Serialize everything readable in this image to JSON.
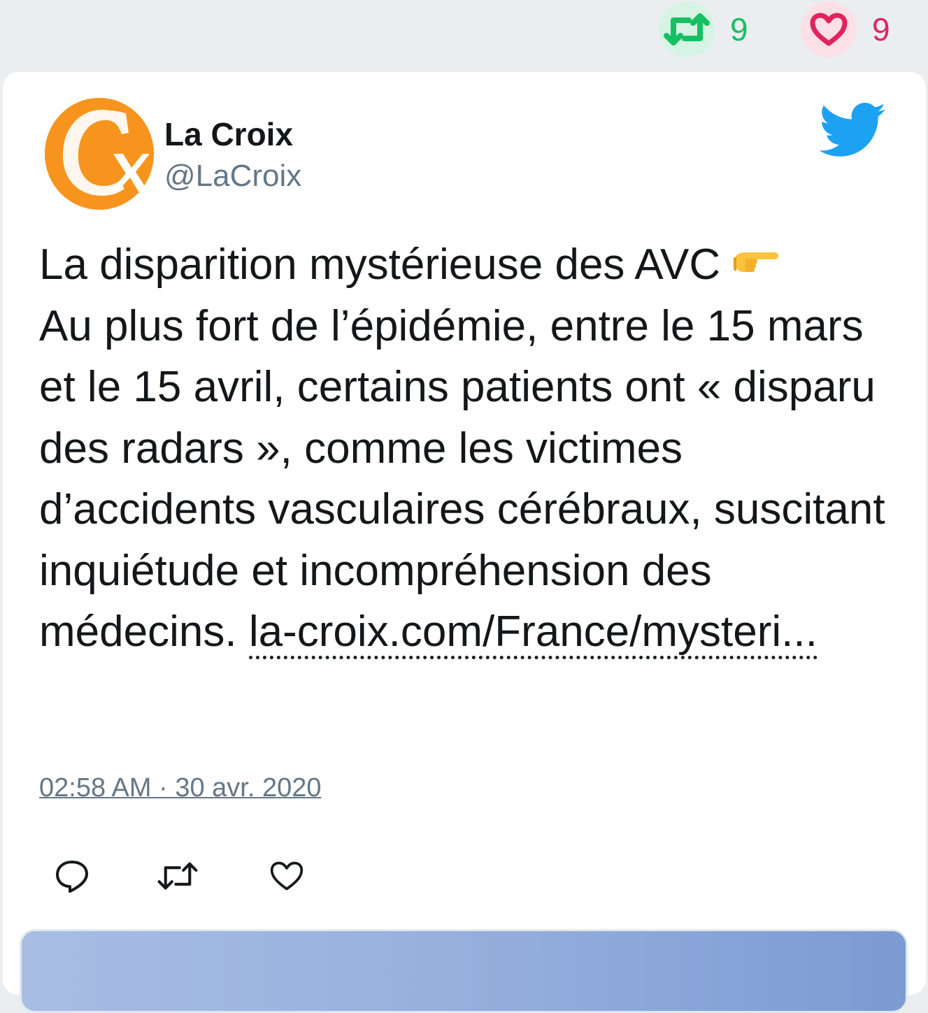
{
  "top_stats": {
    "retweet_count": "9",
    "like_count": "9",
    "retweet_icon": "retweet-icon",
    "like_icon": "heart-icon"
  },
  "tweet": {
    "author_name": "La Croix",
    "author_handle": "@LaCroix",
    "text_line1": "La disparition mystérieuse des AVC ",
    "emoji": "backhand-index-pointing-right",
    "text_body": "\nAu plus fort de l’épidémie, entre le 15 mars et le 15 avril, certains patients ont « disparu des radars », comme les victimes d’accidents vasculaires cérébraux, suscitant inquiétude et incompréhension des médecins. ",
    "link_text": "la-croix.com/France/mysteri...",
    "timestamp": "02:58 AM · 30 avr. 2020"
  },
  "actions": {
    "reply_icon": "reply-icon",
    "retweet_icon": "retweet-icon",
    "like_icon": "heart-icon"
  },
  "colors": {
    "retweet_green": "#17bf63",
    "like_red": "#e0245e",
    "twitter_blue": "#1da1f2",
    "avatar_orange": "#f7941d",
    "muted_text": "#657786",
    "text": "#14171a",
    "background": "#ebeef1"
  }
}
